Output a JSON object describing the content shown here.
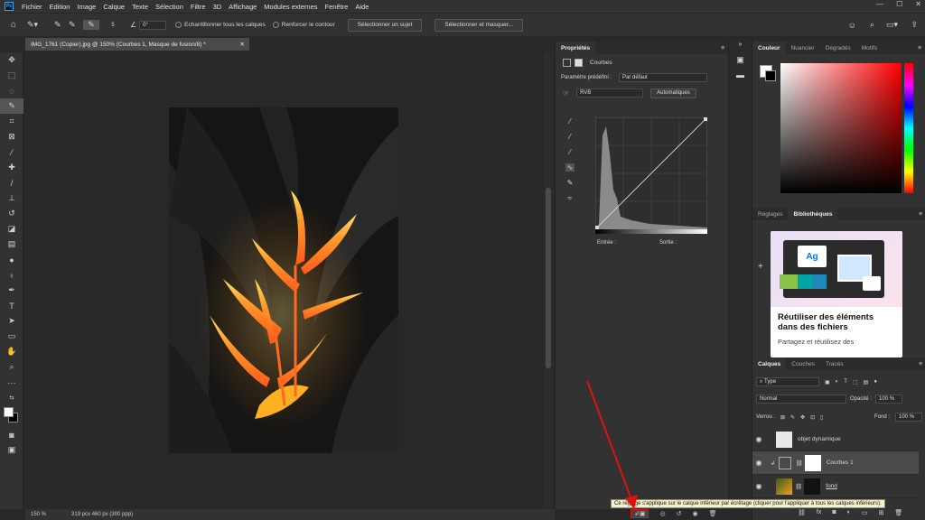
{
  "menu": {
    "logo": "Ps",
    "items": [
      "Fichier",
      "Edition",
      "Image",
      "Calque",
      "Texte",
      "Sélection",
      "Filtre",
      "3D",
      "Affichage",
      "Modules externes",
      "Fenêtre",
      "Aide"
    ]
  },
  "options": {
    "brush_size": "5",
    "angle": "0°",
    "sample_all": "Echantillonner tous les calques",
    "enhance_edge": "Renforcer le contour",
    "select_subject": "Sélectionner un sujet",
    "select_mask": "Sélectionner et masquer..."
  },
  "document": {
    "tab_title": "IMG_1761 (Copier).jpg @ 150% (Courbes 1, Masque de fusion/8) *",
    "zoom": "150 %",
    "size_info": "319 pcx 460 px (300 ppp)"
  },
  "properties": {
    "tab": "Propriétés",
    "adjustment": "Courbes",
    "preset_label": "Paramètre prédéfini :",
    "preset_value": "Par défaut",
    "channel": "RVB",
    "auto": "Automatiques",
    "input_label": "Entrée :",
    "output_label": "Sortie :"
  },
  "color_panel": {
    "tabs": [
      "Couleur",
      "Nuancier",
      "Dégradés",
      "Motifs"
    ],
    "active": "Couleur",
    "accent": "#ff0000"
  },
  "library_panel": {
    "tabs": [
      "Réglages",
      "Bibliothèques"
    ],
    "active": "Bibliothèques",
    "card_title": "Réutiliser des éléments dans des fichiers",
    "card_text": "Partagez et réutilisez des",
    "badge": "Ag"
  },
  "layers_panel": {
    "tabs": [
      "Calques",
      "Couches",
      "Tracés"
    ],
    "active": "Calques",
    "filter": "Type",
    "blend_mode": "Normal",
    "opacity_label": "Opacité :",
    "opacity_value": "100 %",
    "lock_label": "Verrou :",
    "fill_label": "Fond :",
    "fill_value": "100 %",
    "layers": [
      {
        "name": "objet dynamique"
      },
      {
        "name": "Courbes 1"
      },
      {
        "name": "fond"
      }
    ]
  },
  "tooltip": "Ce réglage s'applique sur le calque inférieur par écrêtage (cliquer pour l'appliquer à tous les calques inférieurs)."
}
